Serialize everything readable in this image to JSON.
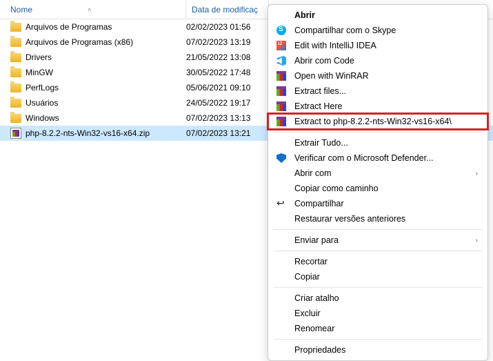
{
  "columns": {
    "name": "Nome",
    "date": "Data de modificaç"
  },
  "files": [
    {
      "icon": "folder",
      "label": "Arquivos de Programas",
      "date": "02/02/2023 01:56",
      "selected": false
    },
    {
      "icon": "folder",
      "label": "Arquivos de Programas (x86)",
      "date": "07/02/2023 13:19",
      "selected": false
    },
    {
      "icon": "folder",
      "label": "Drivers",
      "date": "21/05/2022 13:08",
      "selected": false
    },
    {
      "icon": "folder",
      "label": "MinGW",
      "date": "30/05/2022 17:48",
      "selected": false
    },
    {
      "icon": "folder",
      "label": "PerfLogs",
      "date": "05/06/2021 09:10",
      "selected": false
    },
    {
      "icon": "folder",
      "label": "Usuários",
      "date": "24/05/2022 19:17",
      "selected": false
    },
    {
      "icon": "folder",
      "label": "Windows",
      "date": "07/02/2023 13:13",
      "selected": false
    },
    {
      "icon": "rar",
      "label": "php-8.2.2-nts-Win32-vs16-x64.zip",
      "date": "07/02/2023 13:21",
      "selected": true
    }
  ],
  "context_menu": [
    {
      "type": "item",
      "bold": true,
      "icon": "",
      "label": "Abrir"
    },
    {
      "type": "item",
      "icon": "skype",
      "label": "Compartilhar com o Skype"
    },
    {
      "type": "item",
      "icon": "intellij",
      "label": "Edit with IntelliJ IDEA"
    },
    {
      "type": "item",
      "icon": "vscode",
      "label": "Abrir com Code"
    },
    {
      "type": "item",
      "icon": "winrar",
      "label": "Open with WinRAR"
    },
    {
      "type": "item",
      "icon": "winrar",
      "label": "Extract files..."
    },
    {
      "type": "item",
      "icon": "winrar",
      "label": "Extract Here"
    },
    {
      "type": "item",
      "icon": "winrar",
      "label": "Extract to php-8.2.2-nts-Win32-vs16-x64\\",
      "highlight": true
    },
    {
      "type": "sep"
    },
    {
      "type": "item",
      "icon": "",
      "label": "Extrair Tudo..."
    },
    {
      "type": "item",
      "icon": "shield",
      "label": "Verificar com o Microsoft Defender..."
    },
    {
      "type": "item",
      "icon": "",
      "label": "Abrir com",
      "submenu": true
    },
    {
      "type": "item",
      "icon": "",
      "label": "Copiar como caminho"
    },
    {
      "type": "item",
      "icon": "share",
      "label": "Compartilhar"
    },
    {
      "type": "item",
      "icon": "",
      "label": "Restaurar versões anteriores"
    },
    {
      "type": "sep"
    },
    {
      "type": "item",
      "icon": "",
      "label": "Enviar para",
      "submenu": true
    },
    {
      "type": "sep"
    },
    {
      "type": "item",
      "icon": "",
      "label": "Recortar"
    },
    {
      "type": "item",
      "icon": "",
      "label": "Copiar"
    },
    {
      "type": "sep"
    },
    {
      "type": "item",
      "icon": "",
      "label": "Criar atalho"
    },
    {
      "type": "item",
      "icon": "",
      "label": "Excluir"
    },
    {
      "type": "item",
      "icon": "",
      "label": "Renomear"
    },
    {
      "type": "sep"
    },
    {
      "type": "item",
      "icon": "",
      "label": "Propriedades"
    }
  ]
}
